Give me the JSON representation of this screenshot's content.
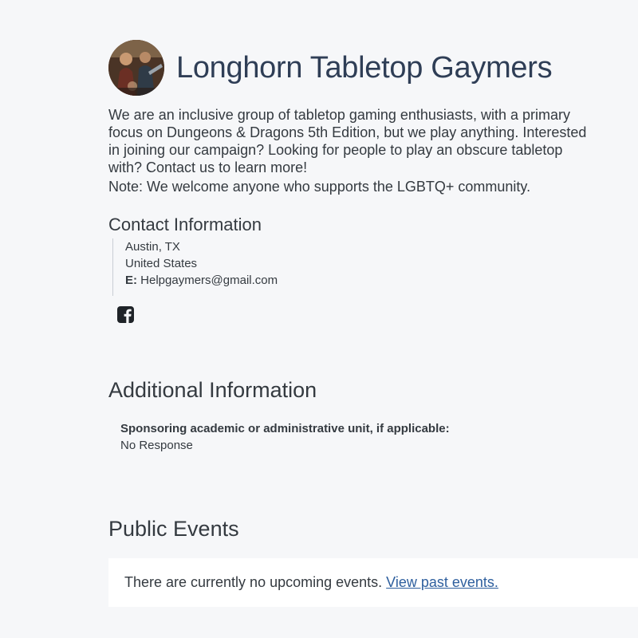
{
  "org": {
    "name": "Longhorn Tabletop Gaymers",
    "avatar_icon": "group-avatar-image"
  },
  "description": {
    "main": "We are an inclusive group of tabletop gaming enthusiasts, with a primary focus on Dungeons & Dragons 5th Edition, but we play anything. Interested in joining our campaign? Looking for people to play an obscure tabletop with? Contact us to learn more!",
    "note": "Note: We welcome anyone who supports the LGBTQ+ community."
  },
  "contact": {
    "title": "Contact Information",
    "city": "Austin, TX",
    "country": "United States",
    "email_label": "E:",
    "email": "Helpgaymers@gmail.com",
    "social_icon": "facebook-icon"
  },
  "additional": {
    "title": "Additional Information",
    "question": "Sponsoring academic or administrative unit, if applicable:",
    "answer": "No Response"
  },
  "events": {
    "title": "Public Events",
    "empty_text": "There are currently no upcoming events.",
    "past_link": "View past events."
  },
  "colors": {
    "background": "#f6f7f9",
    "title": "#2f3e56",
    "link": "#2e5f9e"
  }
}
